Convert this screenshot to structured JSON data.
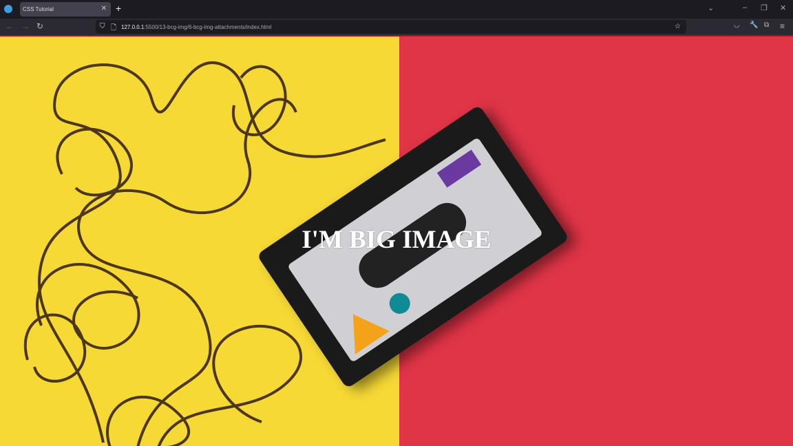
{
  "browser": {
    "tab_title": "CSS Tutorial",
    "url_host": "127.0.0.1",
    "url_rest": ":5500/13-bcg-img/6-bcg-img-attachments/index.html"
  },
  "page": {
    "heading": "I'M BIG IMAGE",
    "colors": {
      "left": "#f6d935",
      "right": "#e03447"
    }
  }
}
